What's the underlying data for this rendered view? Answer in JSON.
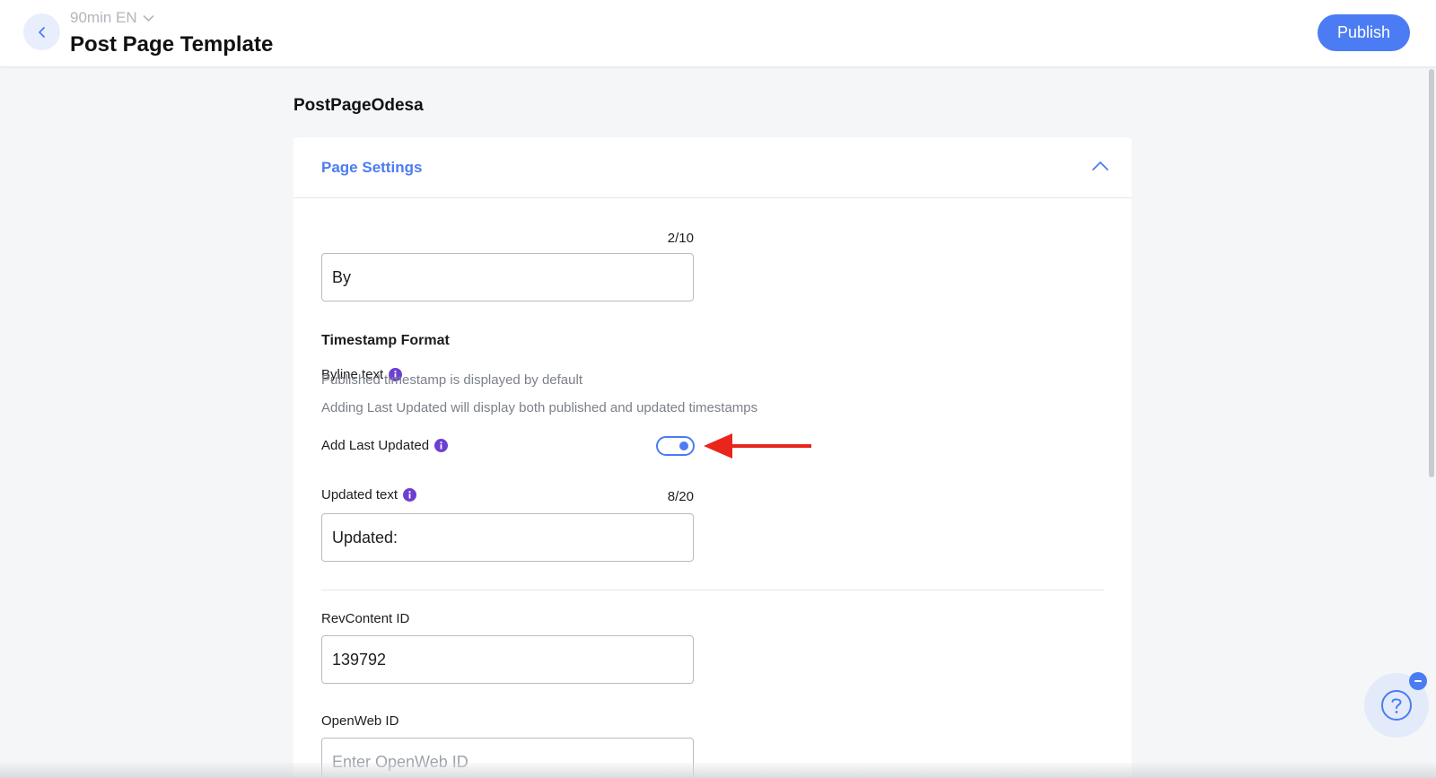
{
  "header": {
    "site_name": "90min EN",
    "title": "Post Page Template",
    "publish_label": "Publish"
  },
  "template": {
    "name": "PostPageOdesa"
  },
  "page_settings": {
    "title": "Page Settings",
    "byline": {
      "label": "Byline text",
      "counter": "2/10",
      "value": "By"
    },
    "timestamp": {
      "title": "Timestamp Format",
      "helper_1": "Published timestamp is displayed by default",
      "helper_2": "Adding Last Updated will display both published and updated timestamps",
      "toggle_label": "Add Last Updated",
      "toggle_on": true
    },
    "updated_text": {
      "label": "Updated text",
      "counter": "8/20",
      "value": "Updated:"
    },
    "revcontent": {
      "label": "RevContent ID",
      "value": "139792"
    },
    "openweb": {
      "label": "OpenWeb ID",
      "value": "",
      "placeholder": "Enter OpenWeb ID"
    }
  },
  "colors": {
    "accent": "#4b7cf3",
    "info": "#6b3fd4",
    "annotation": "#e8261b"
  },
  "icons": {
    "back": "chevron-left-icon",
    "site_switch": "chevron-down-icon",
    "collapse": "chevron-up-icon",
    "info": "info-icon",
    "help": "question-icon",
    "minimize": "minus-icon"
  }
}
